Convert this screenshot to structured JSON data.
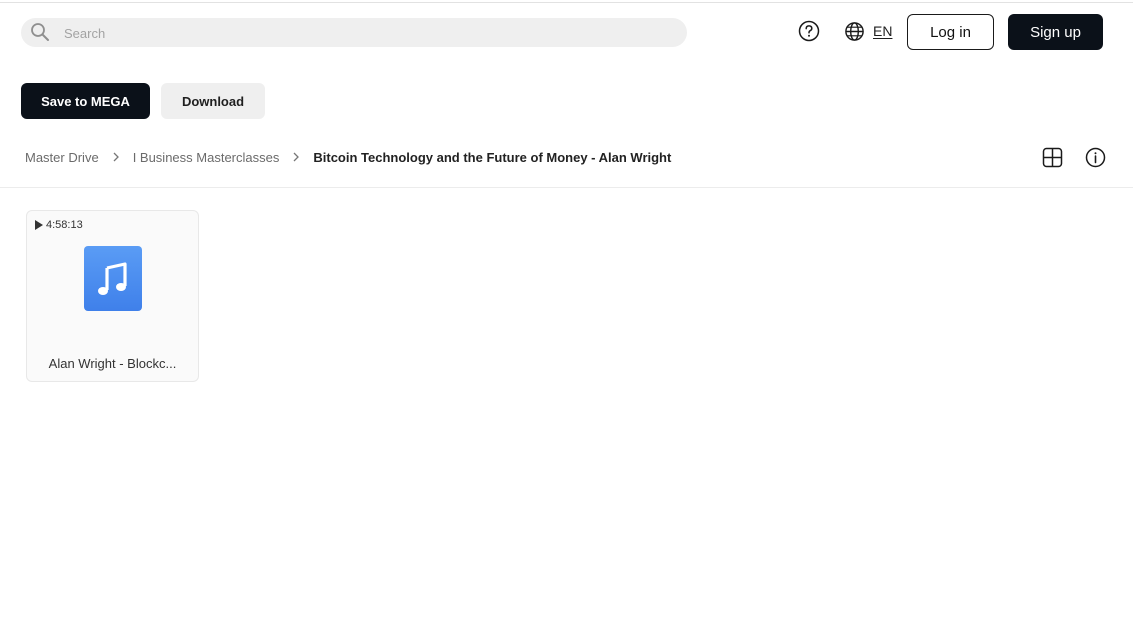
{
  "header": {
    "search_placeholder": "Search",
    "language_code": "EN",
    "login_label": "Log in",
    "signup_label": "Sign up"
  },
  "actions": {
    "save_label": "Save to MEGA",
    "download_label": "Download"
  },
  "breadcrumb": [
    {
      "label": "Master Drive"
    },
    {
      "label": "I Business Masterclasses"
    },
    {
      "label": "Bitcoin Technology and the Future of Money - Alan Wright"
    }
  ],
  "files": [
    {
      "name": "Alan Wright - Blockc...",
      "duration": "4:58:13",
      "type_icon": "music-file-icon"
    }
  ],
  "colors": {
    "primary_button": "#0b1119",
    "secondary_button": "#efefef",
    "audio_icon_blue": "#4a8ef0"
  }
}
